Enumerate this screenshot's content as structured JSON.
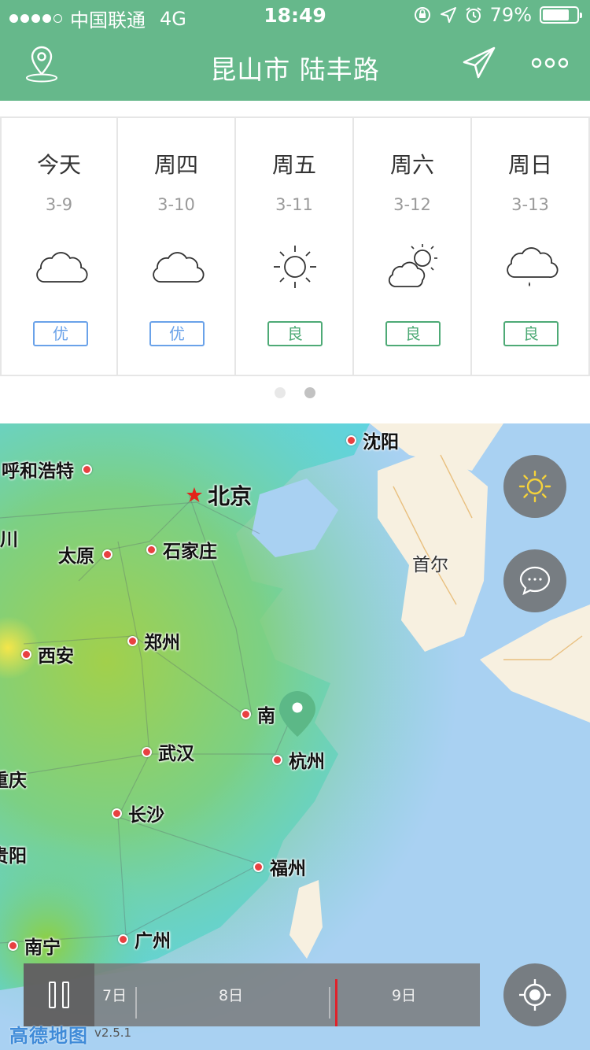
{
  "status_bar": {
    "carrier": "中国联通",
    "network": "4G",
    "time": "18:49",
    "battery": "79%",
    "battery_level": 0.79
  },
  "nav": {
    "title": "昆山市 陆丰路",
    "icons": [
      "location-icon",
      "send-icon",
      "more-icon"
    ]
  },
  "forecast": {
    "days": [
      {
        "name": "今天",
        "date": "3-9",
        "icon": "cloudy",
        "aq": "优",
        "aq_level": "excellent"
      },
      {
        "name": "周四",
        "date": "3-10",
        "icon": "cloudy",
        "aq": "优",
        "aq_level": "excellent"
      },
      {
        "name": "周五",
        "date": "3-11",
        "icon": "sunny",
        "aq": "良",
        "aq_level": "good"
      },
      {
        "name": "周六",
        "date": "3-12",
        "icon": "partly-cloudy",
        "aq": "良",
        "aq_level": "good"
      },
      {
        "name": "周日",
        "date": "3-13",
        "icon": "light-rain",
        "aq": "良",
        "aq_level": "good"
      }
    ],
    "page_count": 2,
    "current_page": 2
  },
  "map": {
    "cities": {
      "shenyang": "沈阳",
      "hohhot": "呼和浩特",
      "beijing": "北京",
      "chuan": "川",
      "taiyuan": "太原",
      "shijiazhuang": "石家庄",
      "seoul": "首尔",
      "xian": "西安",
      "zhengzhou": "郑州",
      "nanjing": "南",
      "wuhan": "武汉",
      "hangzhou": "杭州",
      "chongqing": "重庆",
      "changsha": "长沙",
      "guiyang": "贵阳",
      "fuzhou": "福州",
      "nanning": "南宁",
      "guangzhou": "广州"
    },
    "buttons": [
      "sun-icon",
      "chat-icon",
      "locate-icon"
    ]
  },
  "timeline": {
    "labels": [
      "7日",
      "8日",
      "9日"
    ],
    "state": "playing"
  },
  "brand": {
    "name": "高德地图",
    "version": "v2.5.1"
  },
  "colors": {
    "primary": "#66b88b",
    "aq_excellent": "#6aa2e9",
    "aq_good": "#4eaa76",
    "ocean": "#a9d1f2",
    "timeline_cursor": "#e0212a"
  }
}
